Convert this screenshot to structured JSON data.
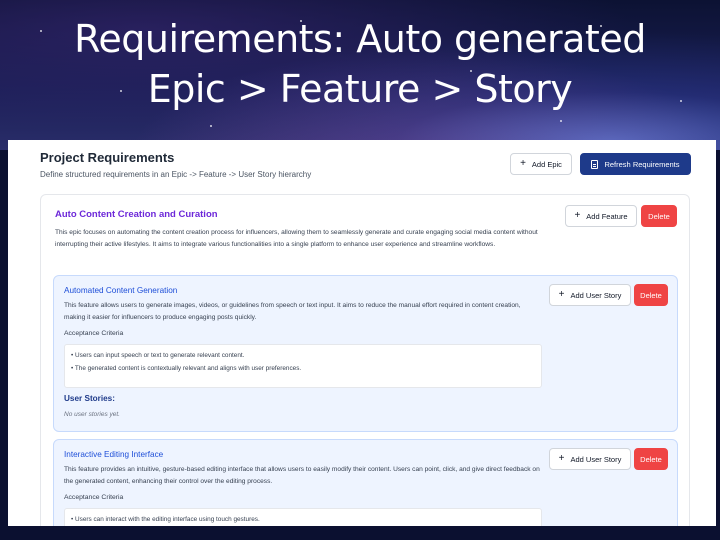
{
  "slide": {
    "title_line1": "Requirements: Auto generated",
    "title_line2": "Epic > Feature > Story"
  },
  "header": {
    "title": "Project Requirements",
    "subtitle": "Define structured requirements in an Epic -> Feature -> User Story hierarchy",
    "add_epic_label": "Add Epic",
    "refresh_label": "Refresh Requirements"
  },
  "epic": {
    "title": "Auto Content Creation and Curation",
    "description": "This epic focuses on automating the content creation process for influencers, allowing them to seamlessly generate and curate engaging social media content without interrupting their active lifestyles. It aims to integrate various functionalities into a single platform to enhance user experience and streamline workflows.",
    "add_feature_label": "Add Feature",
    "delete_label": "Delete"
  },
  "features": [
    {
      "title": "Automated Content Generation",
      "description": "This feature allows users to generate images, videos, or guidelines from speech or text input. It aims to reduce the manual effort required in content creation, making it easier for influencers to produce engaging posts quickly.",
      "acceptance_label": "Acceptance Criteria",
      "criteria": [
        "• Users can input speech or text to generate relevant content.",
        "• The generated content is contextually relevant and aligns with user preferences."
      ],
      "user_stories_label": "User Stories:",
      "user_stories_empty": "No user stories yet.",
      "add_story_label": "Add User Story",
      "delete_label": "Delete"
    },
    {
      "title": "Interactive Editing Interface",
      "description": "This feature provides an intuitive, gesture-based editing interface that allows users to easily modify their content. Users can point, click, and give direct feedback on the generated content, enhancing their control over the editing process.",
      "acceptance_label": "Acceptance Criteria",
      "criteria": [
        "• Users can interact with the editing interface using touch gestures."
      ],
      "add_story_label": "Add User Story",
      "delete_label": "Delete"
    }
  ],
  "colors": {
    "primary": "#1e3a8a",
    "danger": "#ef4444",
    "epic_title": "#6d28d9",
    "feature_title": "#1d4ed8",
    "feature_bg": "#eef4ff"
  }
}
